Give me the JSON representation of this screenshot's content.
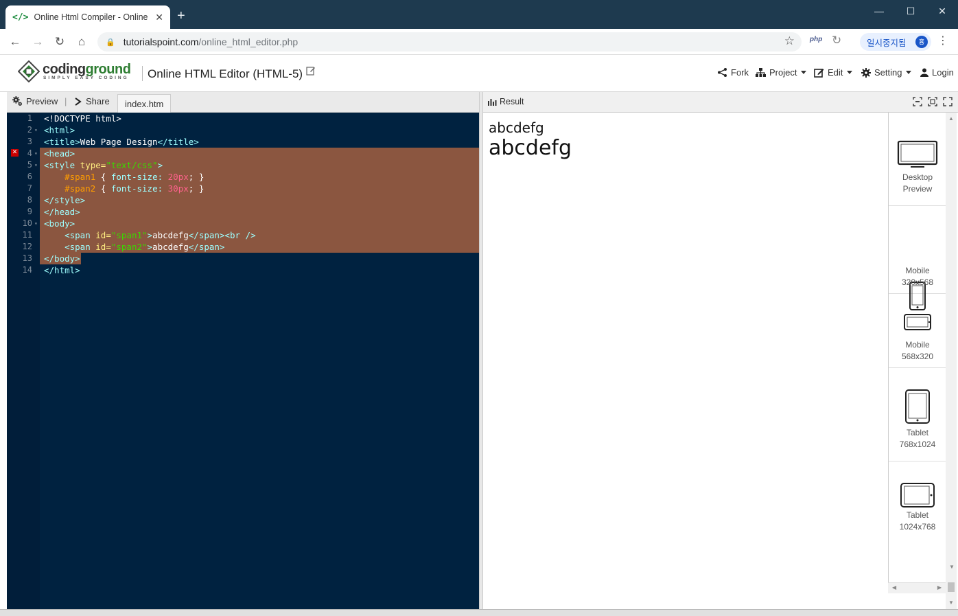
{
  "browser": {
    "tab_title": "Online Html Compiler - Online H",
    "favicon": "</>",
    "url_host": "tutorialspoint.com",
    "url_path": "/online_html_editor.php",
    "ext_php": "php",
    "paused_label": "일시중지됨",
    "avatar_letter": "흉"
  },
  "site": {
    "logo_name_a": "coding",
    "logo_name_b": "ground",
    "logo_tagline": "SIMPLY EASY CODING",
    "page_title": "Online HTML Editor (HTML-5)",
    "menu": {
      "fork": "Fork",
      "project": "Project",
      "edit": "Edit",
      "setting": "Setting",
      "login": "Login"
    }
  },
  "editor": {
    "preview_label": "Preview",
    "share_label": "Share",
    "file_tab": "index.htm",
    "lines": [
      {
        "n": "1",
        "fold": ""
      },
      {
        "n": "2",
        "fold": "▾"
      },
      {
        "n": "3",
        "fold": ""
      },
      {
        "n": "4",
        "fold": "▾"
      },
      {
        "n": "5",
        "fold": "▾"
      },
      {
        "n": "6",
        "fold": ""
      },
      {
        "n": "7",
        "fold": ""
      },
      {
        "n": "8",
        "fold": ""
      },
      {
        "n": "9",
        "fold": ""
      },
      {
        "n": "10",
        "fold": "▾"
      },
      {
        "n": "11",
        "fold": ""
      },
      {
        "n": "12",
        "fold": ""
      },
      {
        "n": "13",
        "fold": ""
      },
      {
        "n": "14",
        "fold": ""
      }
    ],
    "code": {
      "l1": "<!DOCTYPE html>",
      "l2": "<html>",
      "l3_a": "<title>",
      "l3_b": "Web Page Design",
      "l3_c": "</title>",
      "l4": "<head>",
      "l5_a": "<style",
      "l5_b": "type=",
      "l5_c": "\"text/css\"",
      "l5_d": ">",
      "l6_a": "#span1",
      "l6_b": "{",
      "l6_c": "font-size:",
      "l6_d": "20px",
      "l6_e": "; }",
      "l7_a": "#span2",
      "l7_b": "{",
      "l7_c": "font-size:",
      "l7_d": "30px",
      "l7_e": "; }",
      "l8": "</style>",
      "l9": "</head>",
      "l10": "<body>",
      "l11_a": "<span",
      "l11_b": "id=",
      "l11_c": "\"span1\"",
      "l11_d": ">",
      "l11_e": "abcdefg",
      "l11_f": "</span><br />",
      "l12_a": "<span",
      "l12_b": "id=",
      "l12_c": "\"span2\"",
      "l12_d": ">",
      "l12_e": "abcdefg",
      "l12_f": "</span>",
      "l13": "</body>",
      "l14": "</html>"
    }
  },
  "result": {
    "label": "Result",
    "span1": "abcdefg",
    "span2": "abcdefg"
  },
  "devices": [
    {
      "line1": "Desktop",
      "line2": "Preview",
      "icon": "desktop-icon"
    },
    {
      "line1": "Mobile",
      "line2": "320x568",
      "icon": "mobile-portrait-icon"
    },
    {
      "line1": "Mobile",
      "line2": "568x320",
      "icon": "mobile-landscape-icon"
    },
    {
      "line1": "Tablet",
      "line2": "768x1024",
      "icon": "tablet-portrait-icon"
    },
    {
      "line1": "Tablet",
      "line2": "1024x768",
      "icon": "tablet-landscape-icon"
    }
  ],
  "colors": {
    "editor_bg": "#002240",
    "selection": "#8b5640",
    "brand_green": "#2e7d32",
    "chrome_frame": "#1e3a4f"
  }
}
